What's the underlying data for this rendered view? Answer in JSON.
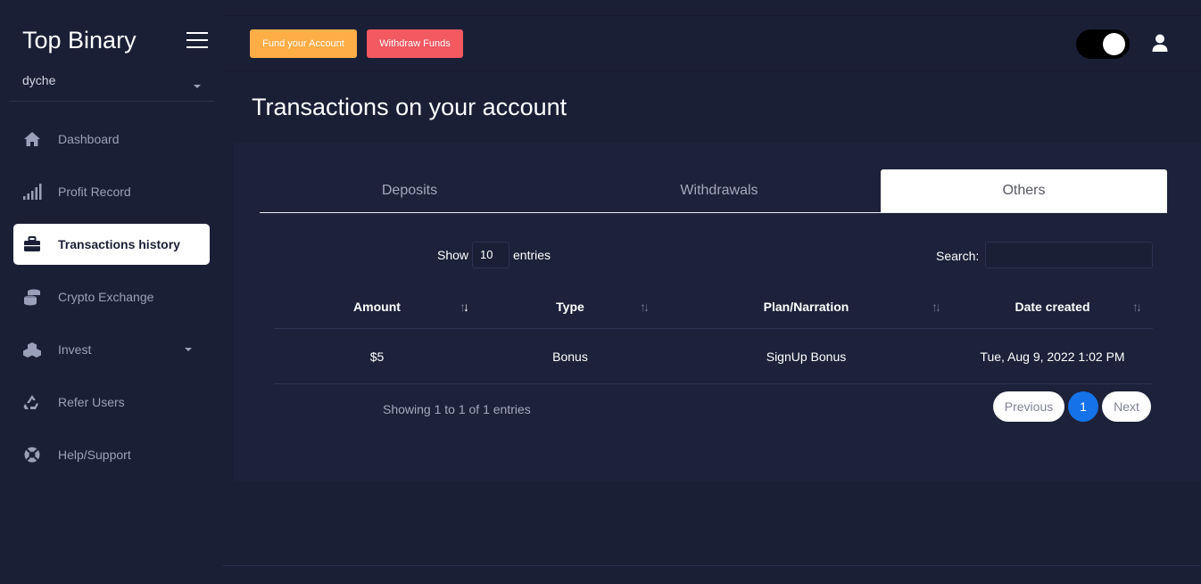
{
  "brand": "Top Binary",
  "user": {
    "name": "dyche"
  },
  "sidebar": {
    "items": [
      {
        "label": "Dashboard",
        "icon": "home-icon"
      },
      {
        "label": "Profit Record",
        "icon": "signal-bars-icon"
      },
      {
        "label": "Transactions history",
        "icon": "briefcase-icon",
        "active": true
      },
      {
        "label": "Crypto Exchange",
        "icon": "coins-icon"
      },
      {
        "label": "Invest",
        "icon": "cubes-icon",
        "has_dropdown": true
      },
      {
        "label": "Refer Users",
        "icon": "recycle-icon"
      },
      {
        "label": "Help/Support",
        "icon": "life-ring-icon"
      }
    ]
  },
  "header": {
    "fund_label": "Fund your Account",
    "withdraw_label": "Withdraw Funds"
  },
  "page": {
    "title": "Transactions on your account"
  },
  "tabs": [
    {
      "label": "Deposits"
    },
    {
      "label": "Withdrawals"
    },
    {
      "label": "Others",
      "active": true
    }
  ],
  "table": {
    "show_label": "Show",
    "page_length": "10",
    "entries_label": "entries",
    "search_label": "Search:",
    "columns": [
      "Amount",
      "Type",
      "Plan/Narration",
      "Date created"
    ],
    "rows": [
      [
        "$5",
        "Bonus",
        "SignUp Bonus",
        "Tue, Aug 9, 2022 1:02 PM"
      ]
    ],
    "info": "Showing 1 to 1 of 1 entries",
    "pagination": {
      "previous": "Previous",
      "current": "1",
      "next": "Next"
    }
  },
  "colors": {
    "background": "#1b1f36",
    "fund_button": "#ffad46",
    "withdraw_button": "#f25961",
    "page_active": "#1572e8"
  }
}
